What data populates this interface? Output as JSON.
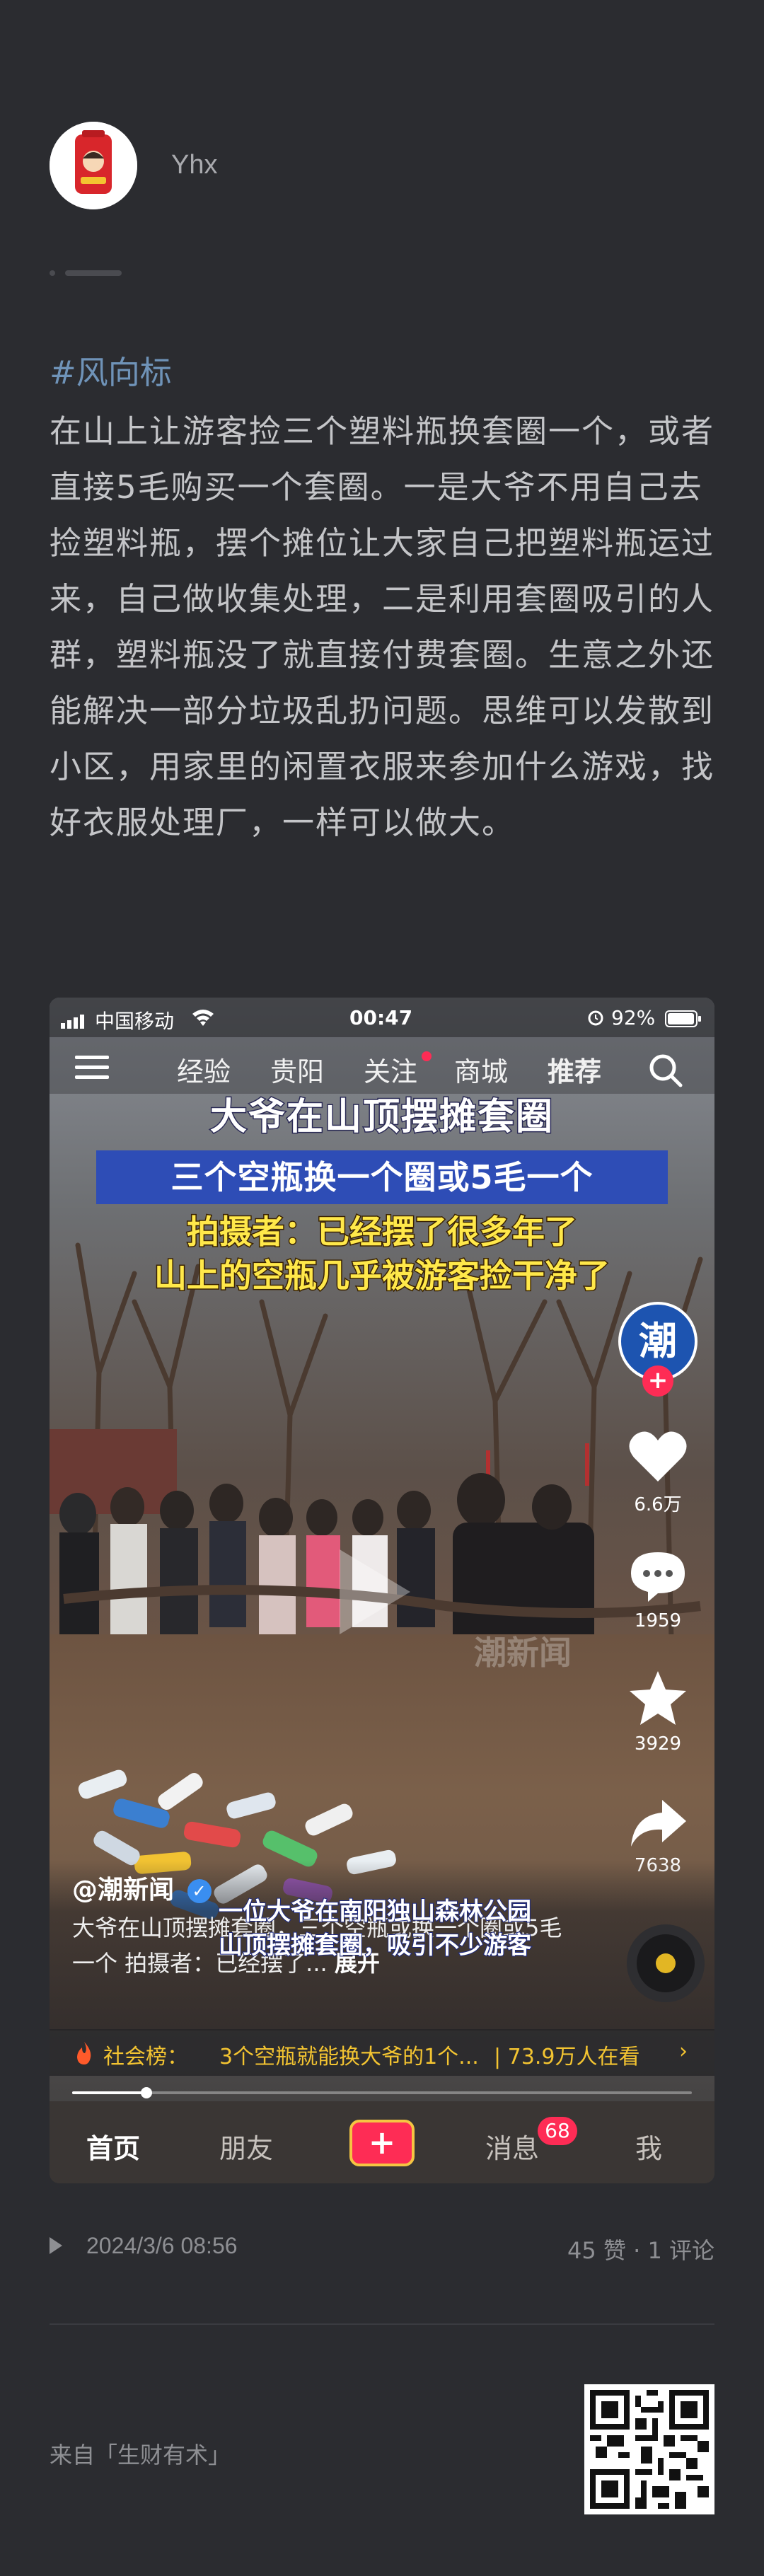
{
  "author": {
    "name": "Yhx"
  },
  "post": {
    "hashtag": "#风向标",
    "text": "在山上让游客捡三个塑料瓶换套圈一个，或者直接5毛购买一个套圈。一是大爷不用自己去捡塑料瓶，摆个摊位让大家自己把塑料瓶运过来，自己做收集处理，二是利用套圈吸引的人群，塑料瓶没了就直接付费套圈。生意之外还能解决一部分垃圾乱扔问题。思维可以发散到小区，用家里的闲置衣服来参加什么游戏，找好衣服处理厂，一样可以做大。"
  },
  "screenshot": {
    "status": {
      "carrier": "中国移动",
      "time": "00:47",
      "battery": "92%"
    },
    "nav": [
      "经验",
      "贵阳",
      "关注",
      "商城",
      "推荐"
    ],
    "overlay": {
      "title": "大爷在山顶摆摊套圈",
      "line2": "三个空瓶换一个圈或5毛一个",
      "line3": "拍摄者：已经摆了很多年了",
      "line4": "山上的空瓶几乎被游客捡干净了"
    },
    "channel_badge": "潮",
    "watermark": "潮新闻",
    "actions": {
      "likes": "6.6万",
      "comments": "1959",
      "favorites": "3929",
      "shares": "7638"
    },
    "caption": {
      "author": "@潮新闻",
      "desc": "大爷在山顶摆摊套圈，三个空瓶或换一个圈或5毛一个 拍摄者：已经摆了...",
      "expand": "展开",
      "subtitle_1": "一位大爷在南阳独山森林公园",
      "subtitle_2": "山顶摆摊套圈，吸引不少游客"
    },
    "hot": {
      "label": "社会榜：",
      "text": "3个空瓶就能换大爷的1个...",
      "count": "| 73.9万人在看"
    },
    "progress": 0.12,
    "tabs": {
      "home": "首页",
      "friends": "朋友",
      "messages": "消息",
      "me": "我",
      "badge": "68"
    }
  },
  "meta": {
    "date": "2024/3/6 08:56",
    "stats": "45 赞 · 1 评论"
  },
  "footer": {
    "source": "来自「生财有术」"
  }
}
